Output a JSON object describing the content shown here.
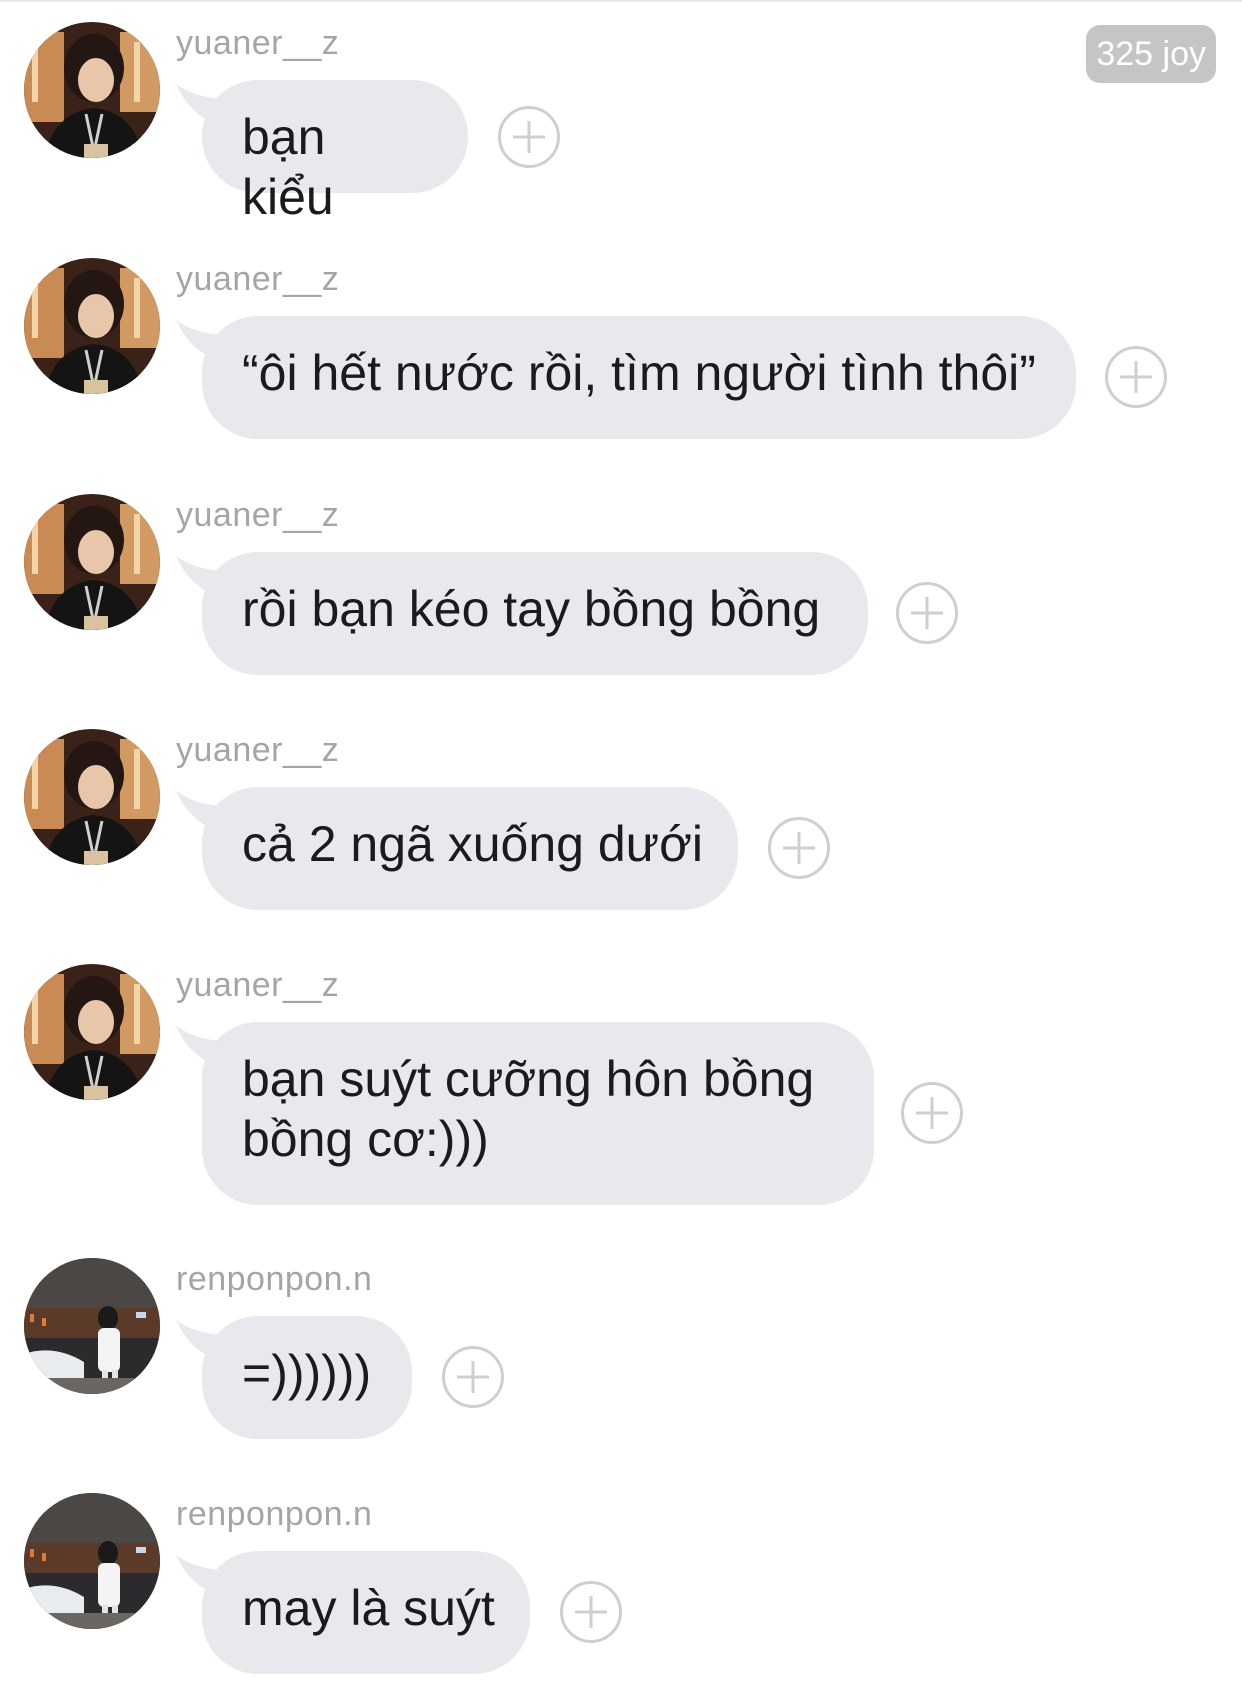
{
  "badge": {
    "label": "325 joy"
  },
  "messages": [
    {
      "user": "yuaner__z",
      "avatar": "avatar-yuaner",
      "text": "bạn kiểu"
    },
    {
      "user": "yuaner__z",
      "avatar": "avatar-yuaner",
      "text": "“ôi hết nước rồi, tìm người tình thôi”"
    },
    {
      "user": "yuaner__z",
      "avatar": "avatar-yuaner",
      "text": "rồi bạn kéo tay bồng bồng"
    },
    {
      "user": "yuaner__z",
      "avatar": "avatar-yuaner",
      "text": "cả 2 ngã xuống dưới"
    },
    {
      "user": "yuaner__z",
      "avatar": "avatar-yuaner",
      "text": "bạn suýt cưỡng hôn bồng bồng cơ:)))"
    },
    {
      "user": "renponpon.n",
      "avatar": "avatar-renponpon",
      "text": "=))))))"
    },
    {
      "user": "renponpon.n",
      "avatar": "avatar-renponpon",
      "text": "may là suýt"
    }
  ],
  "icons": {
    "add": "plus-circle-icon",
    "avatar_a": "profile-photo",
    "avatar_b": "profile-photo"
  },
  "colors": {
    "bubble": "#e8e9ec",
    "username": "#a5a5a9",
    "badge": "#c5c5c8",
    "plus": "#cfcfd2"
  }
}
